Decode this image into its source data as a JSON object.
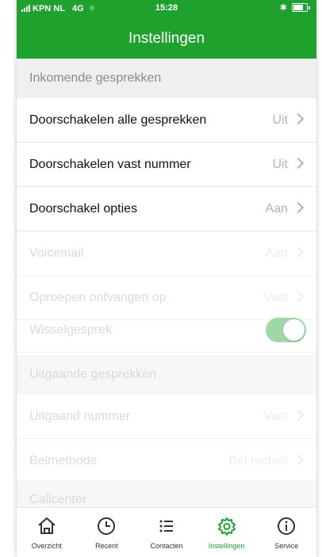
{
  "status_bar": {
    "carrier": "KPN NL",
    "network": "4G",
    "time": "15:28"
  },
  "header": {
    "title": "Instellingen"
  },
  "sections": {
    "incoming": "Inkomende gesprekken",
    "outgoing": "Uitgaande gesprekken",
    "callcenter": "Callcenter"
  },
  "rows": {
    "forward_all": {
      "label": "Doorschakelen alle gesprekken",
      "value": "Uit"
    },
    "forward_fixed": {
      "label": "Doorschakelen vast nummer",
      "value": "Uit"
    },
    "forward_options": {
      "label": "Doorschakel opties",
      "value": "Aan"
    },
    "voicemail": {
      "label": "Voicemail",
      "value": "Aan"
    },
    "receive_on": {
      "label": "Oproepen ontvangen op",
      "value": "Vast"
    },
    "call_waiting": {
      "label": "Wisselgesprek",
      "toggle_on": true
    },
    "outgoing_number": {
      "label": "Uitgaand nummer",
      "value": "Vast"
    },
    "call_method": {
      "label": "Belmethode",
      "value": "Bel mobiel"
    }
  },
  "tabs": [
    {
      "label": "Overzicht",
      "icon": "home-icon"
    },
    {
      "label": "Recent",
      "icon": "clock-icon"
    },
    {
      "label": "Contacten",
      "icon": "list-icon"
    },
    {
      "label": "Instellingen",
      "icon": "gear-icon",
      "active": true
    },
    {
      "label": "Service",
      "icon": "info-icon"
    }
  ],
  "colors": {
    "brand_green": "#1fa22d",
    "toggle_on_dim": "#9fd7a6"
  }
}
